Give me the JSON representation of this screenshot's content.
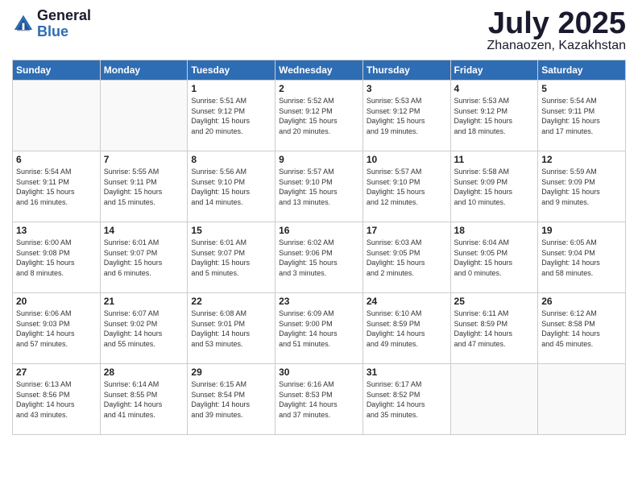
{
  "header": {
    "logo_general": "General",
    "logo_blue": "Blue",
    "month": "July 2025",
    "location": "Zhanaozen, Kazakhstan"
  },
  "weekdays": [
    "Sunday",
    "Monday",
    "Tuesday",
    "Wednesday",
    "Thursday",
    "Friday",
    "Saturday"
  ],
  "weeks": [
    [
      {
        "day": "",
        "info": ""
      },
      {
        "day": "",
        "info": ""
      },
      {
        "day": "1",
        "info": "Sunrise: 5:51 AM\nSunset: 9:12 PM\nDaylight: 15 hours\nand 20 minutes."
      },
      {
        "day": "2",
        "info": "Sunrise: 5:52 AM\nSunset: 9:12 PM\nDaylight: 15 hours\nand 20 minutes."
      },
      {
        "day": "3",
        "info": "Sunrise: 5:53 AM\nSunset: 9:12 PM\nDaylight: 15 hours\nand 19 minutes."
      },
      {
        "day": "4",
        "info": "Sunrise: 5:53 AM\nSunset: 9:12 PM\nDaylight: 15 hours\nand 18 minutes."
      },
      {
        "day": "5",
        "info": "Sunrise: 5:54 AM\nSunset: 9:11 PM\nDaylight: 15 hours\nand 17 minutes."
      }
    ],
    [
      {
        "day": "6",
        "info": "Sunrise: 5:54 AM\nSunset: 9:11 PM\nDaylight: 15 hours\nand 16 minutes."
      },
      {
        "day": "7",
        "info": "Sunrise: 5:55 AM\nSunset: 9:11 PM\nDaylight: 15 hours\nand 15 minutes."
      },
      {
        "day": "8",
        "info": "Sunrise: 5:56 AM\nSunset: 9:10 PM\nDaylight: 15 hours\nand 14 minutes."
      },
      {
        "day": "9",
        "info": "Sunrise: 5:57 AM\nSunset: 9:10 PM\nDaylight: 15 hours\nand 13 minutes."
      },
      {
        "day": "10",
        "info": "Sunrise: 5:57 AM\nSunset: 9:10 PM\nDaylight: 15 hours\nand 12 minutes."
      },
      {
        "day": "11",
        "info": "Sunrise: 5:58 AM\nSunset: 9:09 PM\nDaylight: 15 hours\nand 10 minutes."
      },
      {
        "day": "12",
        "info": "Sunrise: 5:59 AM\nSunset: 9:09 PM\nDaylight: 15 hours\nand 9 minutes."
      }
    ],
    [
      {
        "day": "13",
        "info": "Sunrise: 6:00 AM\nSunset: 9:08 PM\nDaylight: 15 hours\nand 8 minutes."
      },
      {
        "day": "14",
        "info": "Sunrise: 6:01 AM\nSunset: 9:07 PM\nDaylight: 15 hours\nand 6 minutes."
      },
      {
        "day": "15",
        "info": "Sunrise: 6:01 AM\nSunset: 9:07 PM\nDaylight: 15 hours\nand 5 minutes."
      },
      {
        "day": "16",
        "info": "Sunrise: 6:02 AM\nSunset: 9:06 PM\nDaylight: 15 hours\nand 3 minutes."
      },
      {
        "day": "17",
        "info": "Sunrise: 6:03 AM\nSunset: 9:05 PM\nDaylight: 15 hours\nand 2 minutes."
      },
      {
        "day": "18",
        "info": "Sunrise: 6:04 AM\nSunset: 9:05 PM\nDaylight: 15 hours\nand 0 minutes."
      },
      {
        "day": "19",
        "info": "Sunrise: 6:05 AM\nSunset: 9:04 PM\nDaylight: 14 hours\nand 58 minutes."
      }
    ],
    [
      {
        "day": "20",
        "info": "Sunrise: 6:06 AM\nSunset: 9:03 PM\nDaylight: 14 hours\nand 57 minutes."
      },
      {
        "day": "21",
        "info": "Sunrise: 6:07 AM\nSunset: 9:02 PM\nDaylight: 14 hours\nand 55 minutes."
      },
      {
        "day": "22",
        "info": "Sunrise: 6:08 AM\nSunset: 9:01 PM\nDaylight: 14 hours\nand 53 minutes."
      },
      {
        "day": "23",
        "info": "Sunrise: 6:09 AM\nSunset: 9:00 PM\nDaylight: 14 hours\nand 51 minutes."
      },
      {
        "day": "24",
        "info": "Sunrise: 6:10 AM\nSunset: 8:59 PM\nDaylight: 14 hours\nand 49 minutes."
      },
      {
        "day": "25",
        "info": "Sunrise: 6:11 AM\nSunset: 8:59 PM\nDaylight: 14 hours\nand 47 minutes."
      },
      {
        "day": "26",
        "info": "Sunrise: 6:12 AM\nSunset: 8:58 PM\nDaylight: 14 hours\nand 45 minutes."
      }
    ],
    [
      {
        "day": "27",
        "info": "Sunrise: 6:13 AM\nSunset: 8:56 PM\nDaylight: 14 hours\nand 43 minutes."
      },
      {
        "day": "28",
        "info": "Sunrise: 6:14 AM\nSunset: 8:55 PM\nDaylight: 14 hours\nand 41 minutes."
      },
      {
        "day": "29",
        "info": "Sunrise: 6:15 AM\nSunset: 8:54 PM\nDaylight: 14 hours\nand 39 minutes."
      },
      {
        "day": "30",
        "info": "Sunrise: 6:16 AM\nSunset: 8:53 PM\nDaylight: 14 hours\nand 37 minutes."
      },
      {
        "day": "31",
        "info": "Sunrise: 6:17 AM\nSunset: 8:52 PM\nDaylight: 14 hours\nand 35 minutes."
      },
      {
        "day": "",
        "info": ""
      },
      {
        "day": "",
        "info": ""
      }
    ]
  ]
}
